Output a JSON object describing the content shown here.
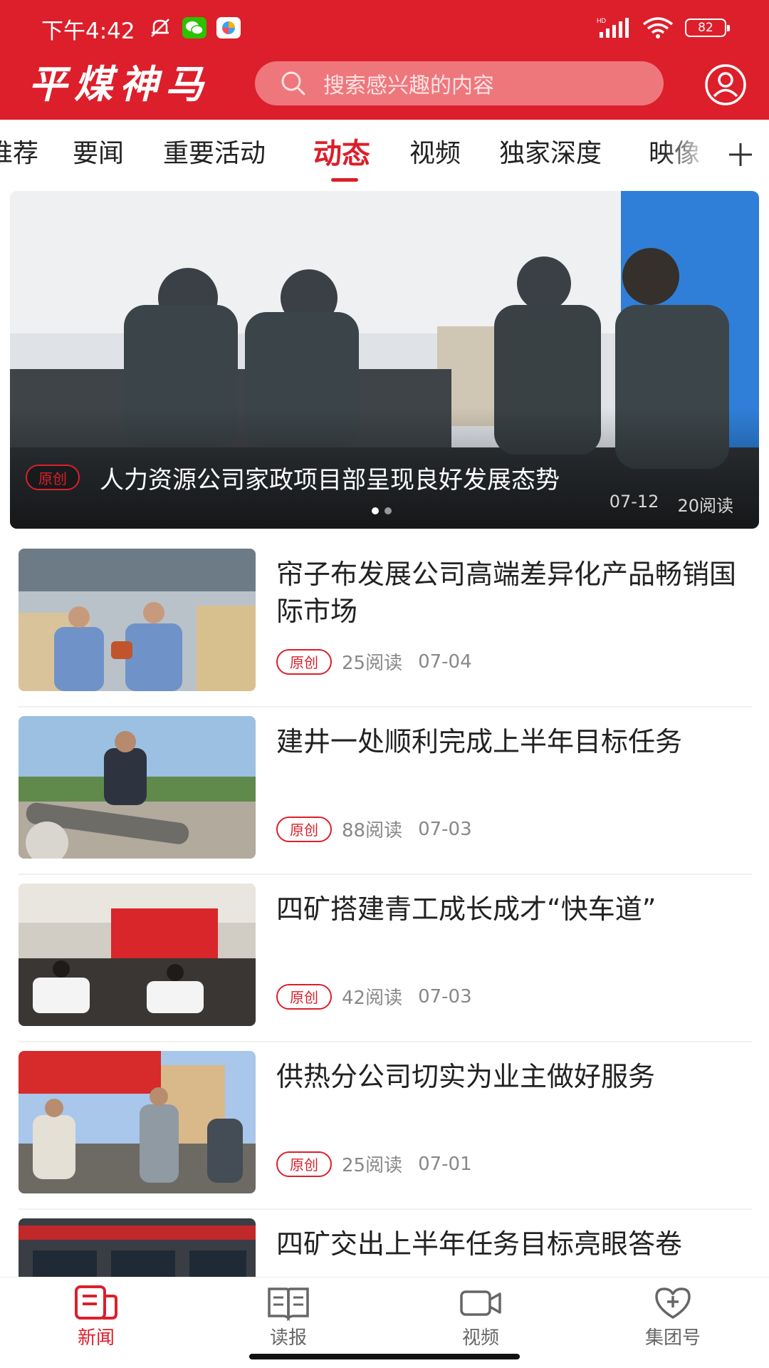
{
  "status_bar": {
    "time": "下午4:42",
    "battery": "82",
    "icons": [
      "mute-bell-icon",
      "wechat-icon",
      "app-icon",
      "hd-signal-icon",
      "wifi-icon",
      "battery-icon"
    ]
  },
  "header": {
    "logo": "平煤神马",
    "search_placeholder": "搜索感兴趣的内容",
    "icons": [
      "search-icon",
      "user-icon"
    ]
  },
  "colors": {
    "brand_red": "#dc1f2b",
    "text": "#222222",
    "meta_gray": "#888888"
  },
  "tabs": [
    {
      "label": "推荐"
    },
    {
      "label": "要闻"
    },
    {
      "label": "重要活动"
    },
    {
      "label": "动态",
      "active": true
    },
    {
      "label": "视频"
    },
    {
      "label": "独家深度"
    },
    {
      "label": "映像"
    }
  ],
  "banner": {
    "badge": "原创",
    "title": "人力资源公司家政项目部呈现良好发展态势",
    "date": "07-12",
    "reads": "20阅读",
    "slide": 1,
    "slide_count": 2
  },
  "articles": [
    {
      "title": "帘子布发展公司高端差异化产品畅销国际市场",
      "badge": "原创",
      "reads": "25阅读",
      "date": "07-04"
    },
    {
      "title": "建井一处顺利完成上半年目标任务",
      "badge": "原创",
      "reads": "88阅读",
      "date": "07-03"
    },
    {
      "title": "四矿搭建青工成长成才“快车道”",
      "badge": "原创",
      "reads": "42阅读",
      "date": "07-03"
    },
    {
      "title": "供热分公司切实为业主做好服务",
      "badge": "原创",
      "reads": "25阅读",
      "date": "07-01"
    },
    {
      "title": "四矿交出上半年任务目标亮眼答卷",
      "badge": "",
      "reads": "",
      "date": ""
    }
  ],
  "bottom_nav": [
    {
      "label": "新闻",
      "icon": "news-icon",
      "active": true
    },
    {
      "label": "读报",
      "icon": "newspaper-book-icon"
    },
    {
      "label": "视频",
      "icon": "video-camera-icon"
    },
    {
      "label": "集团号",
      "icon": "heart-plus-icon"
    }
  ]
}
